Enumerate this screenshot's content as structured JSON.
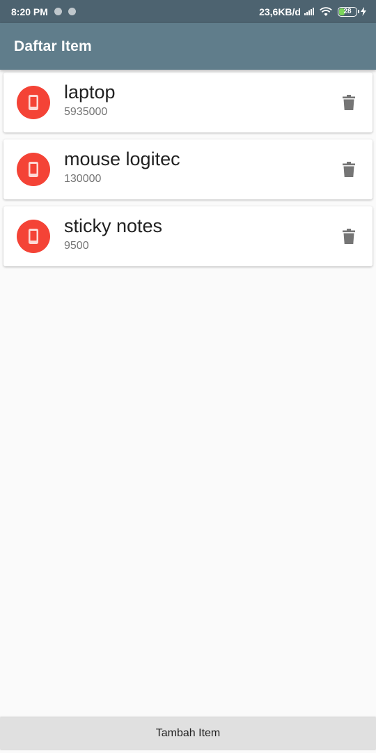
{
  "status_bar": {
    "time": "8:20 PM",
    "net_speed": "23,6KB/d",
    "battery_level": "28",
    "icons": [
      "notification-dot-icon",
      "notification-dot-icon",
      "signal-icon",
      "wifi-icon",
      "battery-icon",
      "charging-bolt-icon"
    ]
  },
  "app_bar": {
    "title": "Daftar Item",
    "color": "#607d8b"
  },
  "items": [
    {
      "name": "laptop",
      "price": "5935000",
      "icon": "phone-icon",
      "action_icon": "trash-icon"
    },
    {
      "name": "mouse logitec",
      "price": "130000",
      "icon": "phone-icon",
      "action_icon": "trash-icon"
    },
    {
      "name": "sticky notes",
      "price": "9500",
      "icon": "phone-icon",
      "action_icon": "trash-icon"
    }
  ],
  "add_button": {
    "label": "Tambah Item"
  },
  "colors": {
    "status_bar": "#4d6370",
    "avatar": "#f44336",
    "background": "#fafafa",
    "button": "#e0e0e0"
  }
}
